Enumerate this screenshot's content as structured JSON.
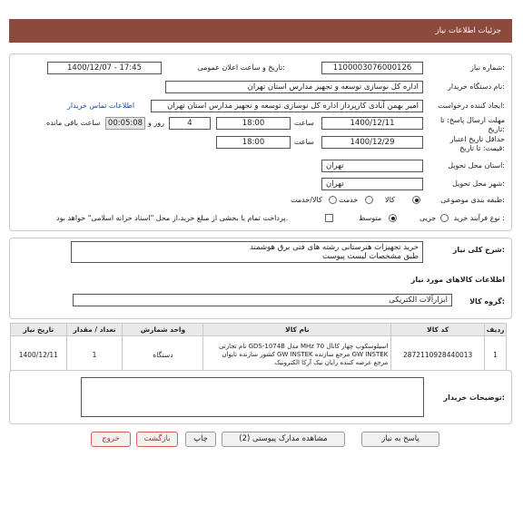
{
  "header": {
    "title": "جزئیات اطلاعات نیاز"
  },
  "need": {
    "number_label": "شماره نیاز:",
    "number": "1100003076000126",
    "announce_label": "تاریخ و ساعت اعلان عمومی:",
    "announce_value": "1400/12/07 - 17:45",
    "buyer_label": "نام دستگاه خریدار:",
    "buyer": "اداره کل نوسازی  توسعه و تجهیز مدارس استان تهران",
    "creator_label": "ایجاد کننده درخواست:",
    "creator": "امیر بهمن آبادی کارپرداز اداره کل نوسازی  توسعه و تجهیز مدارس استان تهران",
    "contact_link": "اطلاعات تماس خریدار",
    "deadline_label": "مهلت ارسال پاسخ: تا تاریخ:",
    "deadline_date": "1400/12/11",
    "time_label": "ساعت",
    "deadline_time": "18:00",
    "days_value": "4",
    "days_label": "روز و",
    "remaining_value": "00:05:08",
    "remaining_label": "ساعت باقی مانده",
    "validity_label": "حداقل تاریخ اعتبار قیمت: تا تاریخ:",
    "validity_date": "1400/12/29",
    "validity_time_label": "ساعت",
    "validity_time": "18:00",
    "province_label": "استان محل تحویل:",
    "province": "تهران",
    "city_label": "شهر محل تحویل:",
    "city": "تهران",
    "category_label": "طبقه بندی موضوعی:",
    "category_options": [
      "کالا",
      "خدمت",
      "کالا/خدمت"
    ],
    "purchase_label": "نوع فرآیند خرید :",
    "purchase_options": [
      "جزیی",
      "متوسط"
    ],
    "payment_note": "پرداخت تمام یا بخشی از مبلغ خرید،از محل \"اسناد خزانه اسلامی\" خواهد بود."
  },
  "description": {
    "label": "شرح کلی نیاز:",
    "line1": "خرید تجهیزات هنرستانی رشته های فنی برق هوشمند",
    "line2": "طبق مشخصات لیست پیوست"
  },
  "goods": {
    "section_title": "اطلاعات کالاهای مورد نیاز",
    "group_label": "گروه کالا:",
    "group_value": "ابزارآلات الکتریکی",
    "columns": [
      "ردیف",
      "کد کالا",
      "نام کالا",
      "واحد شمارش",
      "تعداد / مقدار",
      "تاریخ نیاز"
    ],
    "rows": [
      {
        "row": "1",
        "code": "2872110928440013",
        "name_line1": "اسیلوسکوپ چهار کانال 70 MHz مدل GDS-1074B نام تجارتی",
        "name_line2": "GW INSTEK مرجع سازنده GW INSTEK کشور سازنده تایوان",
        "name_line3": "مرجع عرضه کننده رایان نیک آرکا الکترونیک",
        "unit": "دستگاه",
        "qty": "1",
        "date": "1400/12/11"
      }
    ]
  },
  "buyer_notes": {
    "label": "توضیحات خریدار:"
  },
  "buttons": {
    "reply": "پاسخ به نیاز",
    "docs": "مشاهده مدارک پیوستی (2)",
    "print": "چاپ",
    "back": "بازگشت",
    "exit": "خروج"
  }
}
